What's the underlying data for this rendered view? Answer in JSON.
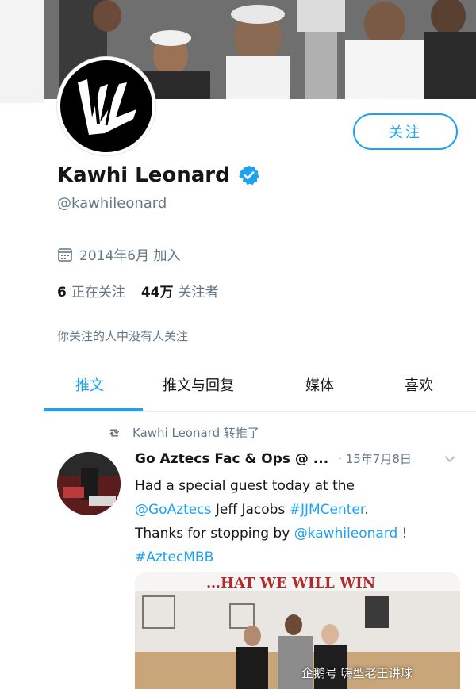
{
  "profile": {
    "name": "Kawhi Leonard",
    "handle": "@kawhileonard",
    "follow_label": "关注",
    "joined": "2014年6月 加入",
    "following_count": "6",
    "following_label": "正在关注",
    "followers_count": "44万",
    "followers_label": "关注者",
    "followers_you_know": "你关注的人中没有人关注"
  },
  "tabs": [
    {
      "label": "推文",
      "active": true
    },
    {
      "label": "推文与回复",
      "active": false
    },
    {
      "label": "媒体",
      "active": false
    },
    {
      "label": "喜欢",
      "active": false
    }
  ],
  "tweet": {
    "retweet_label": "Kawhi Leonard 转推了",
    "author": "Go Aztecs Fac & Ops @ ...",
    "date": "· 15年7月8日",
    "line1": "Had a special guest today at the",
    "mention1": "@GoAztecs",
    "line2_mid": " Jeff Jacobs ",
    "hashtag1": "#JJMCenter",
    "line2_end": ".",
    "line3_start": "Thanks for stopping by ",
    "mention2": "@kawhileonard",
    "line3_end": " !",
    "hashtag2": "#AztecMBB",
    "media_text": "…HAT WE WILL WIN"
  },
  "watermark": "企鹅号 嗨型老王讲球",
  "colors": {
    "accent": "#1da1f2",
    "muted": "#657786",
    "text": "#14171a"
  }
}
